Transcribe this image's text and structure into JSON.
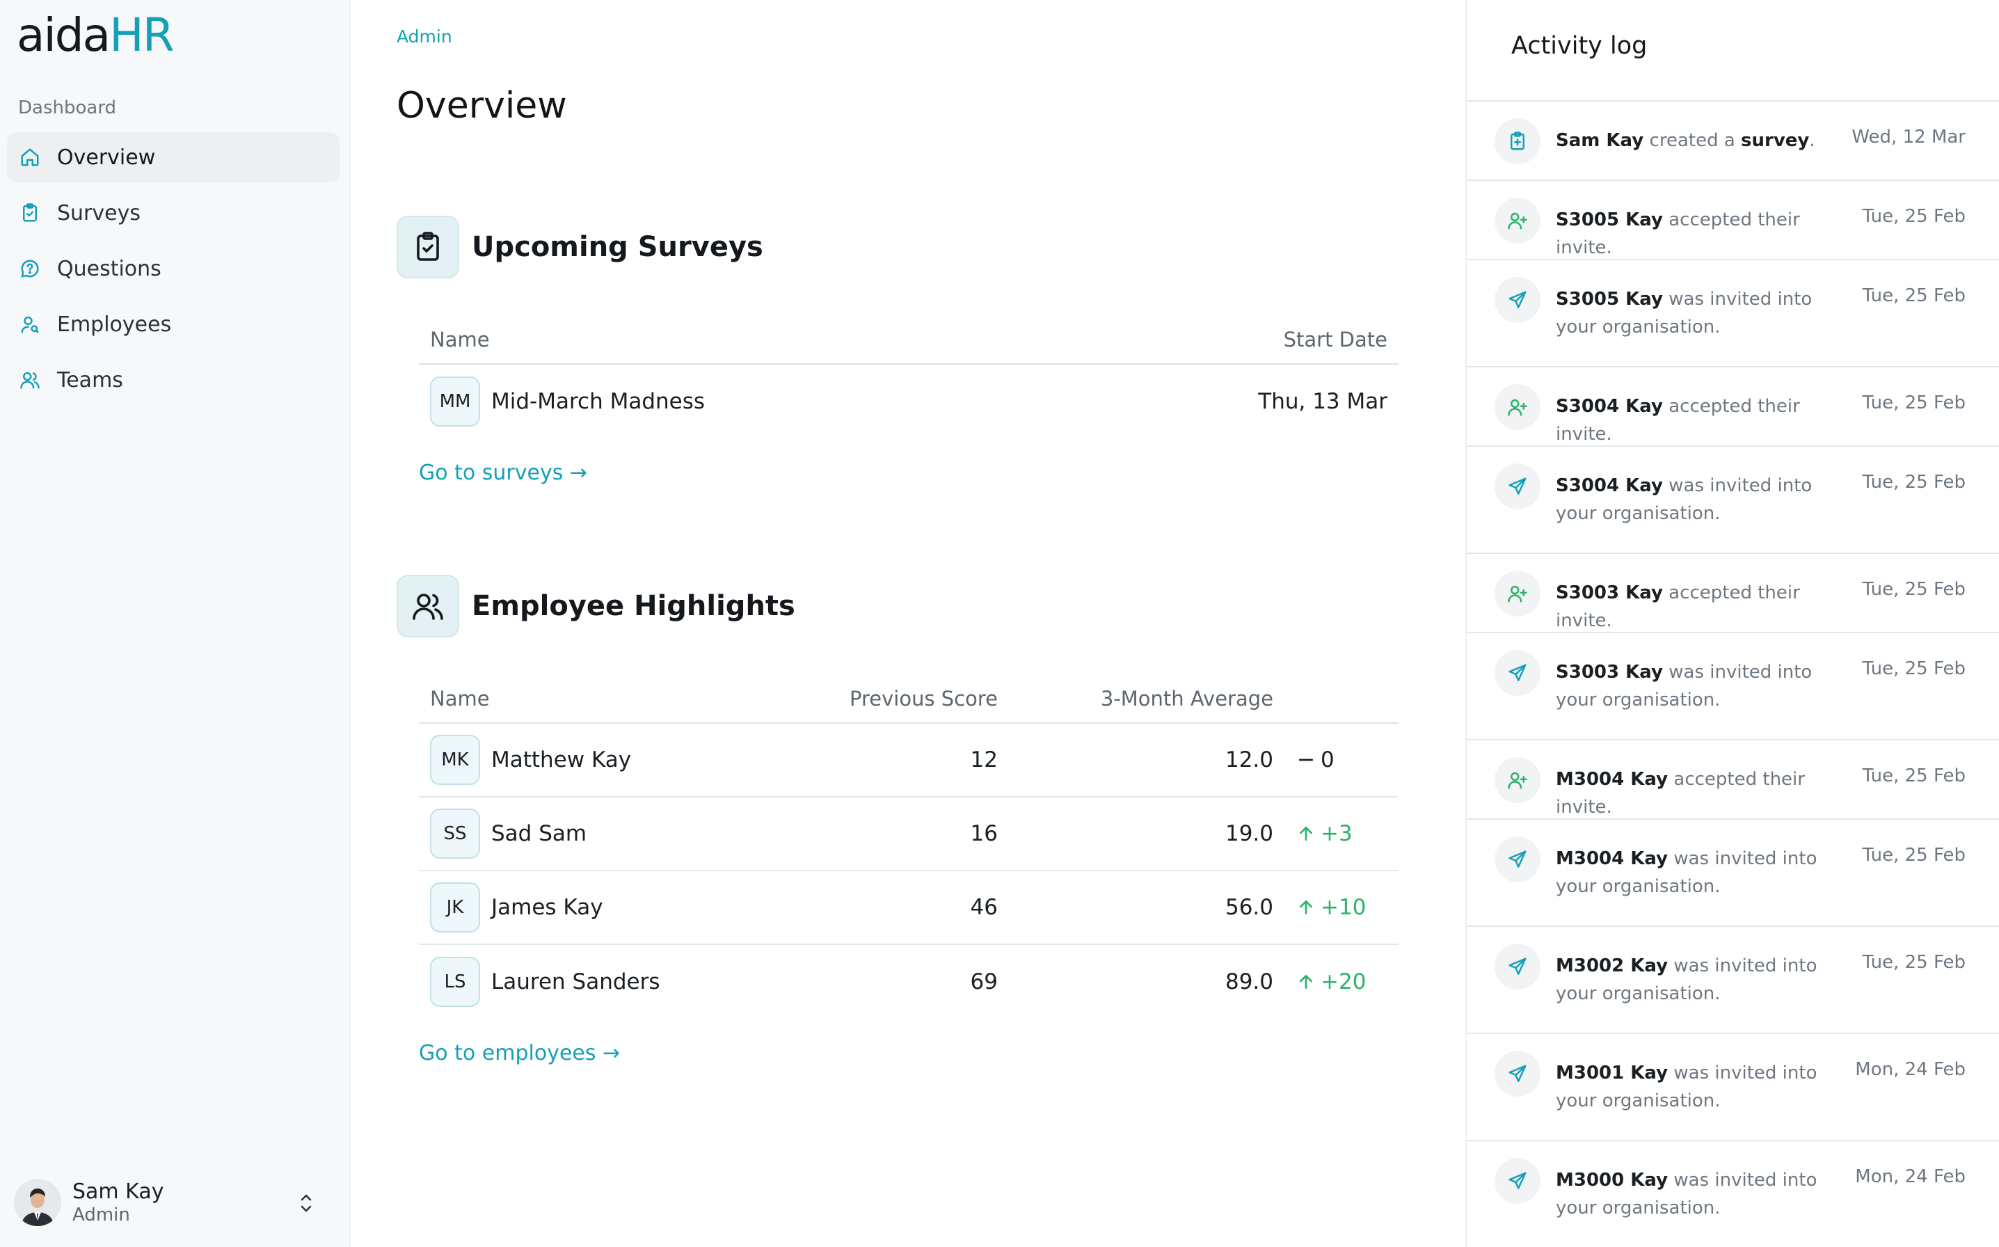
{
  "app": {
    "logo_part1": "aida",
    "logo_part2": "HR",
    "accent": "#14a0b6"
  },
  "sidebar": {
    "section": "Dashboard",
    "items": [
      {
        "label": "Overview",
        "icon": "home-icon",
        "active": true
      },
      {
        "label": "Surveys",
        "icon": "clipboard-icon"
      },
      {
        "label": "Questions",
        "icon": "question-bubble-icon"
      },
      {
        "label": "Employees",
        "icon": "user-search-icon"
      },
      {
        "label": "Teams",
        "icon": "users-icon"
      }
    ],
    "user": {
      "name": "Sam Kay",
      "role": "Admin"
    }
  },
  "header": {
    "breadcrumb": "Admin",
    "title": "Overview"
  },
  "surveys": {
    "title": "Upcoming Surveys",
    "columns": {
      "name": "Name",
      "start": "Start Date"
    },
    "rows": [
      {
        "initials": "MM",
        "name": "Mid-March Madness",
        "start": "Thu, 13 Mar"
      }
    ],
    "link": "Go to surveys →"
  },
  "highlights": {
    "title": "Employee Highlights",
    "columns": {
      "name": "Name",
      "prev": "Previous Score",
      "avg": "3-Month Average"
    },
    "rows": [
      {
        "initials": "MK",
        "name": "Matthew Kay",
        "prev": "12",
        "avg": "12.0",
        "change": "0",
        "trend": "flat"
      },
      {
        "initials": "SS",
        "name": "Sad Sam",
        "prev": "16",
        "avg": "19.0",
        "change": "+3",
        "trend": "up"
      },
      {
        "initials": "JK",
        "name": "James Kay",
        "prev": "46",
        "avg": "56.0",
        "change": "+10",
        "trend": "up"
      },
      {
        "initials": "LS",
        "name": "Lauren Sanders",
        "prev": "69",
        "avg": "89.0",
        "change": "+20",
        "trend": "up"
      }
    ],
    "link": "Go to employees →"
  },
  "activity": {
    "title": "Activity log",
    "items": [
      {
        "icon": "clipboard-plus-icon",
        "actor": "Sam Kay",
        "text": " created a ",
        "object": "survey",
        "tail": ".",
        "date": "Wed, 12 Mar"
      },
      {
        "icon": "user-plus-icon",
        "actor": "S3005 Kay",
        "text": " accepted their invite.",
        "date": "Tue, 25 Feb"
      },
      {
        "icon": "send-icon",
        "actor": "S3005 Kay",
        "text": " was invited into your organisation.",
        "date": "Tue, 25 Feb"
      },
      {
        "icon": "user-plus-icon",
        "actor": "S3004 Kay",
        "text": " accepted their invite.",
        "date": "Tue, 25 Feb"
      },
      {
        "icon": "send-icon",
        "actor": "S3004 Kay",
        "text": " was invited into your organisation.",
        "date": "Tue, 25 Feb"
      },
      {
        "icon": "user-plus-icon",
        "actor": "S3003 Kay",
        "text": " accepted their invite.",
        "date": "Tue, 25 Feb"
      },
      {
        "icon": "send-icon",
        "actor": "S3003 Kay",
        "text": " was invited into your organisation.",
        "date": "Tue, 25 Feb"
      },
      {
        "icon": "user-plus-icon",
        "actor": "M3004 Kay",
        "text": " accepted their invite.",
        "date": "Tue, 25 Feb"
      },
      {
        "icon": "send-icon",
        "actor": "M3004 Kay",
        "text": " was invited into your organisation.",
        "date": "Tue, 25 Feb"
      },
      {
        "icon": "send-icon",
        "actor": "M3002 Kay",
        "text": " was invited into your organisation.",
        "date": "Tue, 25 Feb"
      },
      {
        "icon": "send-icon",
        "actor": "M3001 Kay",
        "text": " was invited into your organisation.",
        "date": "Mon, 24 Feb"
      },
      {
        "icon": "send-icon",
        "actor": "M3000 Kay",
        "text": " was invited into your organisation.",
        "date": "Mon, 24 Feb"
      }
    ]
  }
}
